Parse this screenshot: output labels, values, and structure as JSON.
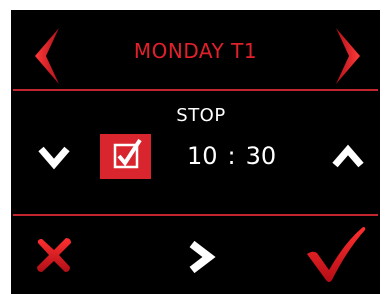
{
  "header": {
    "title": "MONDAY T1",
    "prev_icon": "chevron-left-icon",
    "next_icon": "chevron-right-icon"
  },
  "event": {
    "label": "STOP",
    "enabled": true,
    "time": {
      "hours": "10",
      "separator": ":",
      "minutes": "30"
    }
  },
  "controls": {
    "decrease_icon": "chevron-down-icon",
    "increase_icon": "chevron-up-icon",
    "cancel_icon": "close-icon",
    "forward_icon": "chevron-right-icon",
    "confirm_icon": "check-icon"
  },
  "colors": {
    "background": "#000000",
    "accent": "#e2202b",
    "divider": "#c2252d",
    "text": "#ffffff"
  }
}
